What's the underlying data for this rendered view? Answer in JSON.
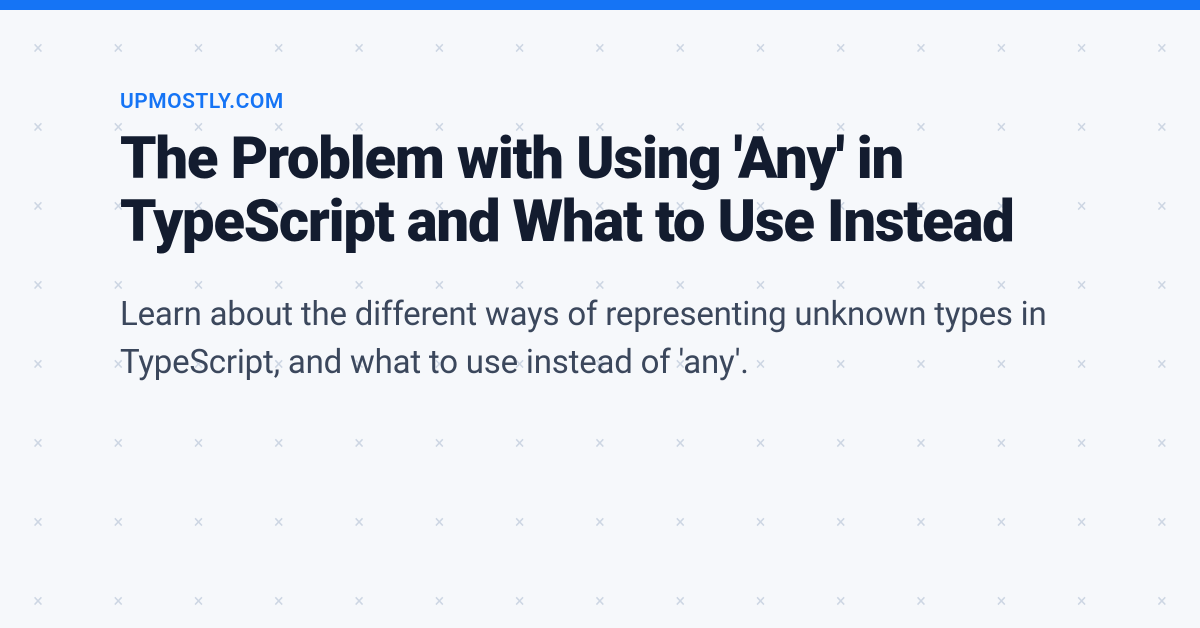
{
  "site_label": "UPMOSTLY.COM",
  "title": "The Problem with Using 'Any' in TypeScript and What to Use Instead",
  "description": "Learn about the different ways of representing unknown types in TypeScript, and what to use instead of 'any'.",
  "colors": {
    "accent": "#1574f5",
    "title_color": "#131c2f",
    "text_color": "#3b475c",
    "bg": "#f6f8fb",
    "pattern": "#cdd6e3"
  },
  "pattern_glyph": "×"
}
